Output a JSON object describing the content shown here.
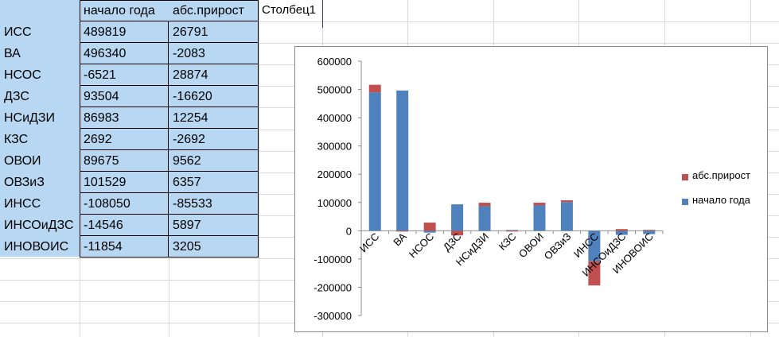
{
  "header": {
    "col_b": "начало года",
    "col_c": "абс.прирост",
    "col_d": "Столбец1"
  },
  "rows": [
    {
      "label": "ИСС",
      "start": "489819",
      "growth": "26791"
    },
    {
      "label": "ВА",
      "start": "496340",
      "growth": "-2083"
    },
    {
      "label": "НСОС",
      "start": "-6521",
      "growth": "28874"
    },
    {
      "label": "ДЗС",
      "start": "93504",
      "growth": "-16620"
    },
    {
      "label": "НСиДЗИ",
      "start": "86983",
      "growth": "12254"
    },
    {
      "label": "КЗС",
      "start": "2692",
      "growth": "-2692"
    },
    {
      "label": "ОВОИ",
      "start": "89675",
      "growth": "9562"
    },
    {
      "label": "ОВЗиЗ",
      "start": "101529",
      "growth": "6357"
    },
    {
      "label": "ИНСС",
      "start": "-108050",
      "growth": "-85533"
    },
    {
      "label": "ИНСОиДЗС",
      "start": "-14546",
      "growth": "5897"
    },
    {
      "label": "ИНОВОИС",
      "start": "-11854",
      "growth": "3205"
    }
  ],
  "colors": {
    "start": "#4f81bd",
    "growth": "#c0504d",
    "selection": "#b8d7f2"
  },
  "chart_data": {
    "type": "bar",
    "stacked": true,
    "categories": [
      "ИСС",
      "ВА",
      "НСОС",
      "ДЗС",
      "НСиДЗИ",
      "КЗС",
      "ОВОИ",
      "ОВЗиЗ",
      "ИНСС",
      "ИНСОиДЗС",
      "ИНОВОИС"
    ],
    "series": [
      {
        "name": "начало года",
        "values": [
          489819,
          496340,
          -6521,
          93504,
          86983,
          2692,
          89675,
          101529,
          -108050,
          -14546,
          -11854
        ]
      },
      {
        "name": "абс.прирост",
        "values": [
          26791,
          -2083,
          28874,
          -16620,
          12254,
          -2692,
          9562,
          6357,
          -85533,
          5897,
          3205
        ]
      }
    ],
    "yticks": [
      "600000",
      "500000",
      "400000",
      "300000",
      "200000",
      "100000",
      "0",
      "-100000",
      "-200000",
      "-300000"
    ],
    "ylim": [
      -300000,
      600000
    ],
    "legend_position": "right",
    "legend": [
      "абс.прирост",
      "начало года"
    ]
  }
}
